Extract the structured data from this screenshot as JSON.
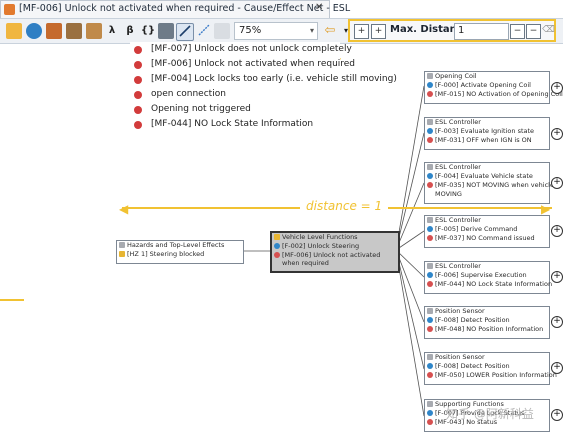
{
  "window": {
    "tab_title": "[MF-006] Unlock not activated when required - Cause/Effect Net - ESL",
    "close_glyph": "✕"
  },
  "toolbar": {
    "zoom_value": "75%",
    "max_distance_label": "Max. Distance:",
    "max_distance_value": "1",
    "symbols": [
      "λ",
      "β",
      "{}"
    ]
  },
  "dropdown": {
    "items": [
      "[MF-007] Unlock does not unlock completely",
      "[MF-006] Unlock not activated when required",
      "[MF-004] Lock locks too early (i.e. vehicle still moving)",
      "open connection",
      "Opening not triggered",
      "[MF-044] NO Lock State Information"
    ]
  },
  "annotation": {
    "distance_label": "distance = 1"
  },
  "center_node": {
    "header": "Vehicle Level Functions",
    "rows": [
      "[F-002] Unlock Steering",
      "[MF-006] Unlock not activated when required"
    ]
  },
  "hazard_node": {
    "header": "Hazards and Top-Level Effects",
    "rows": [
      "[HZ 1] Steering blocked"
    ]
  },
  "right_nodes": [
    {
      "header": "Opening Coil",
      "rows": [
        "[F-000] Activate Opening Coil",
        "[MF-015] NO Activation of Opening Coil"
      ]
    },
    {
      "header": "ESL Controller",
      "rows": [
        "[F-003] Evaluate Ignition state",
        "[MF-031] OFF when IGN is ON"
      ]
    },
    {
      "header": "ESL Controller",
      "rows": [
        "[F-004] Evaluate Vehicle state",
        "[MF-035] NOT MOVING when vehicle is",
        "MOVING"
      ]
    },
    {
      "header": "ESL Controller",
      "rows": [
        "[F-005] Derive Command",
        "[MF-037] NO Command issued"
      ]
    },
    {
      "header": "ESL Controller",
      "rows": [
        "[F-006] Supervise Execution",
        "[MF-044] NO Lock State Information"
      ]
    },
    {
      "header": "Position Sensor",
      "rows": [
        "[F-008] Detect Position",
        "[MF-048] NO Position Information"
      ]
    },
    {
      "header": "Position Sensor",
      "rows": [
        "[F-008] Detect Position",
        "[MF-050] LOWER Position Information"
      ]
    },
    {
      "header": "Supporting Functions",
      "rows": [
        "[F-007] Provide Lock Status",
        "[MF-043] No status"
      ]
    }
  ],
  "watermark": "知乎 @阿新科益"
}
